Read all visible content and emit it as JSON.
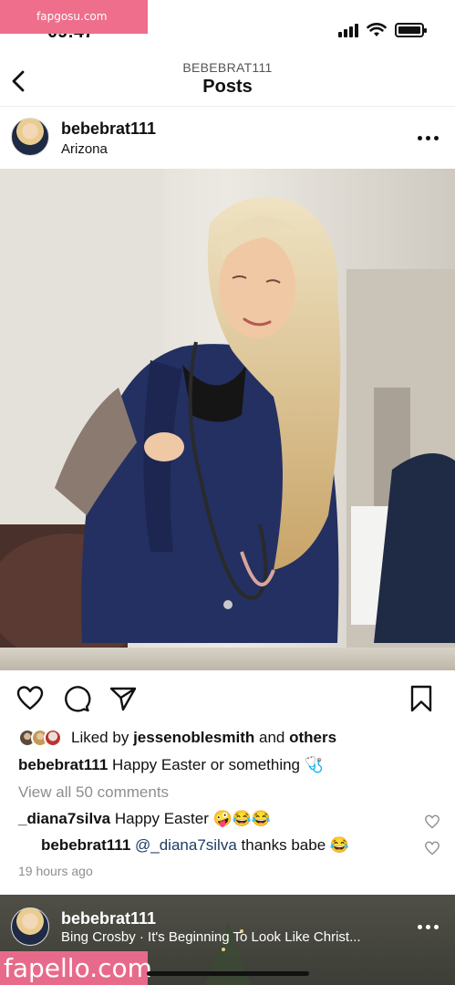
{
  "status_bar": {
    "time": "09:47"
  },
  "watermark_top": "fapgosu.com",
  "header": {
    "account": "BEBEBRAT111",
    "title": "Posts"
  },
  "post": {
    "username": "bebebrat111",
    "location": "Arizona",
    "likes": {
      "prefix": "Liked by",
      "user": "jessenoblesmith",
      "joiner": "and",
      "others": "others"
    },
    "caption": {
      "username": "bebebrat111",
      "text": "Happy Easter or something 🩺"
    },
    "view_comments": "View all 50 comments",
    "comments": [
      {
        "username": "_diana7silva",
        "text": "Happy Easter 🤪😂😂"
      },
      {
        "username": "bebebrat111",
        "mention": "@_diana7silva",
        "text": "thanks babe 😂"
      }
    ],
    "time_ago": "19 hours ago"
  },
  "next_post": {
    "username": "bebebrat111",
    "song": "Bing Crosby · It's Beginning To Look Like Christ..."
  },
  "watermark_bottom": "fapello.com",
  "icons": [
    "back-arrow-icon",
    "more-icon",
    "heart-icon",
    "comment-icon",
    "share-icon",
    "bookmark-icon",
    "wifi-icon",
    "signal-icon",
    "battery-icon"
  ]
}
